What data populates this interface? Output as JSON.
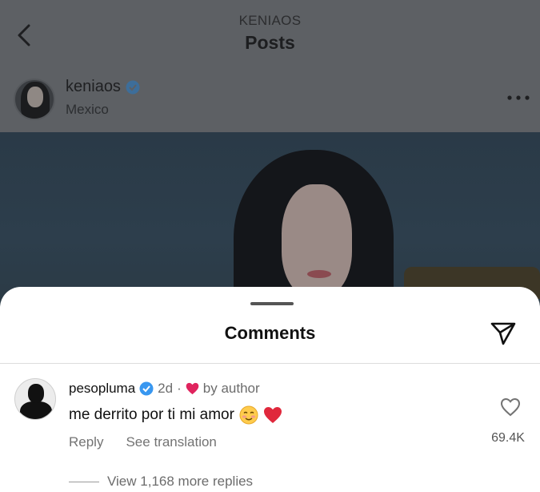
{
  "header": {
    "handle": "KENIAOS",
    "title": "Posts"
  },
  "post": {
    "username": "keniaos",
    "location": "Mexico"
  },
  "comments_sheet": {
    "title": "Comments"
  },
  "comment": {
    "username": "pesopluma",
    "time": "2d",
    "separator": "·",
    "liked_by": "by author",
    "text": "me derrito por ti mi amor",
    "reply_label": "Reply",
    "translate_label": "See translation",
    "like_count": "69.4K",
    "view_replies": "View 1,168 more replies"
  },
  "colors": {
    "verified": "#3897f0",
    "heart": "#e0245e",
    "sheet_bg": "#ffffff",
    "dim_bg": "#5d6064"
  },
  "icons": [
    "back-icon",
    "verified-icon",
    "more-icon",
    "share-icon",
    "heart-icon",
    "like-icon"
  ]
}
